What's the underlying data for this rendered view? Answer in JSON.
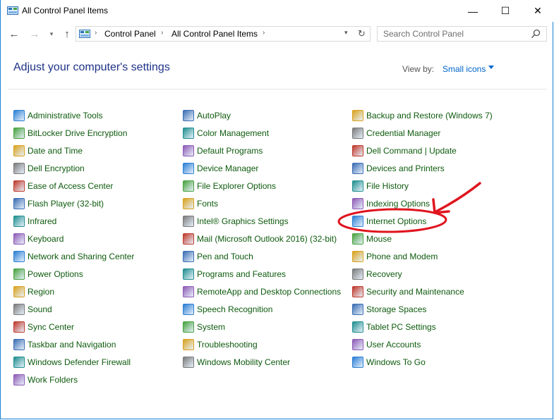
{
  "window": {
    "title": "All Control Panel Items"
  },
  "titlebar": {
    "minimize_glyph": "—",
    "maximize_glyph": "☐",
    "close_glyph": "✕"
  },
  "nav": {
    "back_glyph": "←",
    "forward_glyph": "→",
    "recent_glyph": "▾",
    "up_glyph": "↑"
  },
  "address": {
    "crumbs": [
      "Control Panel",
      "All Control Panel Items"
    ],
    "sep_glyph": "›",
    "dropdown_glyph": "▾",
    "refresh_glyph": "↻"
  },
  "search": {
    "placeholder": "Search Control Panel",
    "icon": "search-icon"
  },
  "header": {
    "title": "Adjust your computer's settings",
    "view_by_label": "View by:",
    "view_by_value": "Small icons"
  },
  "colors": {
    "link": "#0d5a0d",
    "heading": "#1e3287",
    "accent": "#0066cc",
    "annotation": "#e0141e"
  },
  "columns": [
    {
      "items": [
        {
          "label": "Administrative Tools",
          "icon": "admin-tools-icon"
        },
        {
          "label": "BitLocker Drive Encryption",
          "icon": "bitlocker-icon"
        },
        {
          "label": "Date and Time",
          "icon": "clock-icon"
        },
        {
          "label": "Dell Encryption",
          "icon": "dell-encryption-icon"
        },
        {
          "label": "Ease of Access Center",
          "icon": "ease-of-access-icon"
        },
        {
          "label": "Flash Player (32-bit)",
          "icon": "flash-icon"
        },
        {
          "label": "Infrared",
          "icon": "infrared-icon"
        },
        {
          "label": "Keyboard",
          "icon": "keyboard-icon"
        },
        {
          "label": "Network and Sharing Center",
          "icon": "network-icon"
        },
        {
          "label": "Power Options",
          "icon": "power-icon"
        },
        {
          "label": "Region",
          "icon": "globe-icon"
        },
        {
          "label": "Sound",
          "icon": "speaker-icon"
        },
        {
          "label": "Sync Center",
          "icon": "sync-icon"
        },
        {
          "label": "Taskbar and Navigation",
          "icon": "taskbar-icon"
        },
        {
          "label": "Windows Defender Firewall",
          "icon": "firewall-icon"
        },
        {
          "label": "Work Folders",
          "icon": "folder-icon"
        }
      ]
    },
    {
      "items": [
        {
          "label": "AutoPlay",
          "icon": "autoplay-icon"
        },
        {
          "label": "Color Management",
          "icon": "monitor-color-icon"
        },
        {
          "label": "Default Programs",
          "icon": "default-programs-icon"
        },
        {
          "label": "Device Manager",
          "icon": "device-manager-icon"
        },
        {
          "label": "File Explorer Options",
          "icon": "folder-options-icon"
        },
        {
          "label": "Fonts",
          "icon": "fonts-icon"
        },
        {
          "label": "Intel® Graphics Settings",
          "icon": "intel-graphics-icon"
        },
        {
          "label": "Mail (Microsoft Outlook 2016) (32-bit)",
          "icon": "mail-icon"
        },
        {
          "label": "Pen and Touch",
          "icon": "pen-icon"
        },
        {
          "label": "Programs and Features",
          "icon": "programs-icon"
        },
        {
          "label": "RemoteApp and Desktop Connections",
          "icon": "remoteapp-icon"
        },
        {
          "label": "Speech Recognition",
          "icon": "microphone-icon"
        },
        {
          "label": "System",
          "icon": "system-icon"
        },
        {
          "label": "Troubleshooting",
          "icon": "troubleshoot-icon"
        },
        {
          "label": "Windows Mobility Center",
          "icon": "mobility-icon"
        }
      ]
    },
    {
      "items": [
        {
          "label": "Backup and Restore (Windows 7)",
          "icon": "backup-icon"
        },
        {
          "label": "Credential Manager",
          "icon": "credential-icon"
        },
        {
          "label": "Dell Command | Update",
          "icon": "dell-update-icon"
        },
        {
          "label": "Devices and Printers",
          "icon": "printer-icon"
        },
        {
          "label": "File History",
          "icon": "file-history-icon"
        },
        {
          "label": "Indexing Options",
          "icon": "indexing-icon"
        },
        {
          "label": "Internet Options",
          "icon": "internet-options-icon"
        },
        {
          "label": "Mouse",
          "icon": "mouse-icon"
        },
        {
          "label": "Phone and Modem",
          "icon": "phone-icon"
        },
        {
          "label": "Recovery",
          "icon": "recovery-icon"
        },
        {
          "label": "Security and Maintenance",
          "icon": "flag-icon"
        },
        {
          "label": "Storage Spaces",
          "icon": "storage-icon"
        },
        {
          "label": "Tablet PC Settings",
          "icon": "tablet-icon"
        },
        {
          "label": "User Accounts",
          "icon": "users-icon"
        },
        {
          "label": "Windows To Go",
          "icon": "windows-to-go-icon"
        }
      ]
    }
  ]
}
